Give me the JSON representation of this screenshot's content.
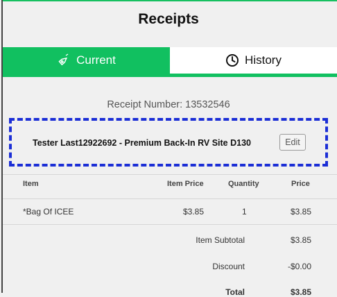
{
  "header": {
    "title": "Receipts"
  },
  "tabs": [
    {
      "label": "Current",
      "active": true,
      "icon": "tag-icon"
    },
    {
      "label": "History",
      "active": false,
      "icon": "clock-icon"
    }
  ],
  "receipt": {
    "number_text": "Receipt Number: 13532546"
  },
  "site": {
    "description": "Tester Last12922692 - Premium Back-In RV Site D130",
    "edit_label": "Edit"
  },
  "table": {
    "columns": [
      "Item",
      "Item Price",
      "Quantity",
      "Price"
    ],
    "rows": [
      {
        "item": "*Bag Of ICEE",
        "item_price": "$3.85",
        "quantity": "1",
        "price": "$3.85"
      }
    ]
  },
  "summary": {
    "subtotal_label": "Item Subtotal",
    "subtotal_value": "$3.85",
    "discount_label": "Discount",
    "discount_value": "-$0.00",
    "total_label": "Total",
    "total_value": "$3.85"
  },
  "colors": {
    "accent": "#11c060",
    "dashed_border": "#1b2ed6"
  }
}
